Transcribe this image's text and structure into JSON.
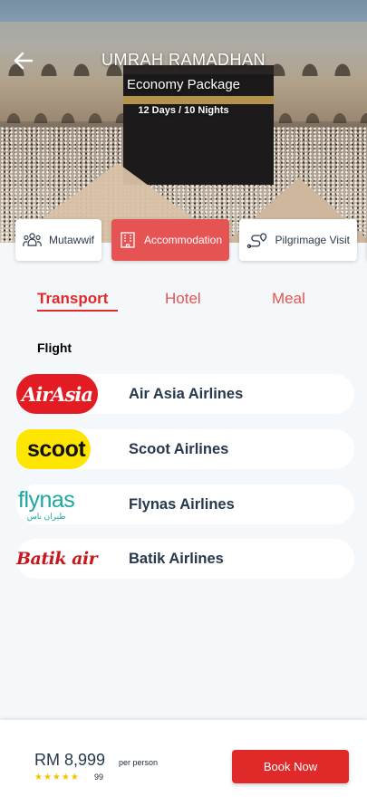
{
  "header": {
    "title": "UMRAH RAMADHAN",
    "package": "Economy Package",
    "duration": "12 Days / 10 Nights",
    "back_icon": "arrow-left-icon"
  },
  "categories": [
    {
      "label": "Mutawwif",
      "icon": "people-icon",
      "active": false
    },
    {
      "label": "Accommodation",
      "icon": "building-icon",
      "active": true
    },
    {
      "label": "Pilgrimage Visit",
      "icon": "route-icon",
      "active": false
    }
  ],
  "tabs": [
    {
      "label": "Transport",
      "active": true
    },
    {
      "label": "Hotel",
      "active": false
    },
    {
      "label": "Meal",
      "active": false
    }
  ],
  "section": {
    "label": "Flight"
  },
  "airlines": [
    {
      "name": "Air Asia Airlines",
      "logo_text": "AirAsia"
    },
    {
      "name": "Scoot Airlines",
      "logo_text": "scoot"
    },
    {
      "name": "Flynas Airlines",
      "logo_text": "flynas",
      "logo_subtext": "طيران ناس"
    },
    {
      "name": "Batik Airlines",
      "logo_text": "Batik air"
    }
  ],
  "footer": {
    "price": "RM 8,999",
    "per_label": "per person",
    "stars": "★★★★★",
    "rating_count": "99",
    "book_label": "Book Now"
  },
  "colors": {
    "accent": "#e02a2a",
    "chip_active": "#e65353",
    "text_dark": "#26384c",
    "star": "#f2c200"
  }
}
